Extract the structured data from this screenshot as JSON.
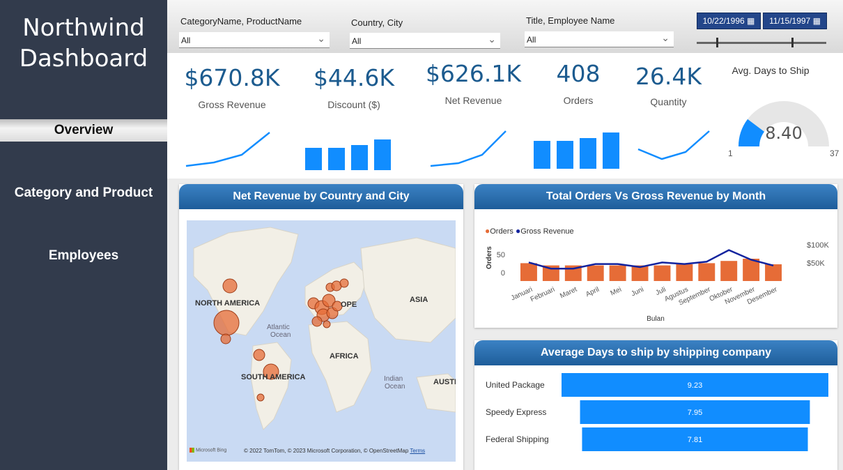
{
  "sidebar": {
    "title_line1": "Northwind",
    "title_line2": "Dashboard",
    "items": [
      {
        "label": "Overview",
        "active": true
      },
      {
        "label": "Category and Product",
        "active": false
      },
      {
        "label": "Employees",
        "active": false
      }
    ]
  },
  "filters": {
    "category": {
      "label": "CategoryName, ProductName",
      "value": "All"
    },
    "country": {
      "label": "Country, City",
      "value": "All"
    },
    "employee": {
      "label": "Title, Employee Name",
      "value": "All"
    },
    "date_start": "10/22/1996",
    "date_end": "11/15/1997"
  },
  "kpis": [
    {
      "value": "$670.8K",
      "label": "Gross Revenue",
      "spark": "line"
    },
    {
      "value": "$44.6K",
      "label": "Discount ($)",
      "spark": "bar"
    },
    {
      "value": "$626.1K",
      "label": "Net Revenue",
      "spark": "line"
    },
    {
      "value": "408",
      "label": "Orders",
      "spark": "bar"
    },
    {
      "value": "26.4K",
      "label": "Quantity",
      "spark": "line"
    }
  ],
  "gauge": {
    "title": "Avg. Days to Ship",
    "value": 8.4,
    "value_text": "8.40",
    "min": 1,
    "max": 37,
    "min_text": "1",
    "max_text": "37"
  },
  "map_panel": {
    "title": "Net Revenue by Country and City",
    "labels": {
      "north_america": "NORTH AMERICA",
      "europe": "OPE",
      "asia": "ASIA",
      "africa": "AFRICA",
      "south_america": "SOUTH AMERICA",
      "atlantic": "Atlantic",
      "ocean1": "Ocean",
      "indian": "Indian",
      "ocean2": "Ocean",
      "australia": "AUSTR"
    },
    "credit": "© 2022 TomTom, © 2023 Microsoft Corporation, © OpenStreetMap",
    "terms": "Terms",
    "brand": "Microsoft Bing"
  },
  "colors": {
    "accent_blue": "#118dff",
    "orange": "#e66c37",
    "navy": "#12239e",
    "sidebar": "#323b4c"
  },
  "chart_data": [
    {
      "type": "bar",
      "title": "Total Orders Vs Gross Revenue by Month",
      "legend": [
        "Orders",
        "Gross Revenue"
      ],
      "legend_placement": "top-left",
      "xlabel": "Bulan",
      "ylabel": "Orders",
      "y_ticks": [
        "0",
        "50"
      ],
      "y2_ticks": [
        "$50K",
        "$100K"
      ],
      "categories": [
        "Januari",
        "Februari",
        "Maret",
        "April",
        "Mei",
        "Juni",
        "Juli",
        "Agustus",
        "September",
        "Oktober",
        "November",
        "Desember"
      ],
      "series": [
        {
          "name": "Orders",
          "kind": "bar",
          "values": [
            32,
            28,
            28,
            28,
            28,
            28,
            28,
            30,
            32,
            36,
            40,
            30
          ]
        },
        {
          "name": "Gross Revenue",
          "kind": "line",
          "values": [
            48,
            32,
            32,
            44,
            44,
            36,
            48,
            44,
            50,
            80,
            55,
            40
          ]
        }
      ],
      "ylim": [
        0,
        60
      ],
      "y2lim": [
        0,
        110
      ]
    },
    {
      "type": "bar",
      "orientation": "horizontal",
      "title": "Average Days to ship by shipping company",
      "categories": [
        "United Package",
        "Speedy Express",
        "Federal Shipping"
      ],
      "values": [
        9.23,
        7.95,
        7.81
      ],
      "value_labels": [
        "9.23",
        "7.95",
        "7.81"
      ]
    }
  ]
}
